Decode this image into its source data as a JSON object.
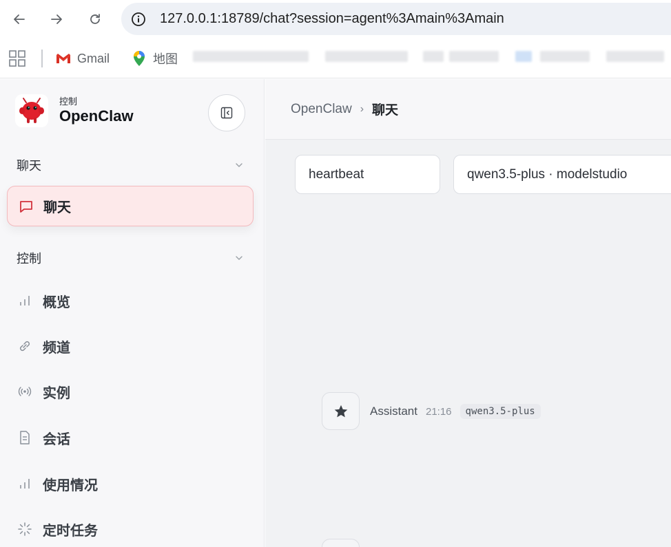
{
  "browser": {
    "url": "127.0.0.1:18789/chat?session=agent%3Amain%3Amain",
    "bookmarks": [
      {
        "label": "Gmail",
        "icon": "gmail-icon"
      },
      {
        "label": "地图",
        "icon": "maps-icon"
      }
    ]
  },
  "sidebar": {
    "brand_sub": "控制",
    "brand_title": "OpenClaw",
    "groups": [
      {
        "label": "聊天"
      },
      {
        "label": "控制"
      }
    ],
    "active_item": {
      "label": "聊天",
      "icon": "chat-bubble-icon"
    },
    "items": [
      {
        "label": "概览",
        "icon": "bar-chart-icon"
      },
      {
        "label": "频道",
        "icon": "link-icon"
      },
      {
        "label": "实例",
        "icon": "broadcast-icon"
      },
      {
        "label": "会话",
        "icon": "document-icon"
      },
      {
        "label": "使用情况",
        "icon": "bar-chart-icon"
      },
      {
        "label": "定时任务",
        "icon": "loader-icon"
      }
    ]
  },
  "main": {
    "breadcrumb": {
      "root": "OpenClaw",
      "separator": "›",
      "current": "聊天"
    },
    "session_select": "heartbeat",
    "model_select": "qwen3.5-plus · modelstudio",
    "message": {
      "sender": "Assistant",
      "time": "21:16",
      "model": "qwen3.5-plus",
      "avatar_icon": "star-icon"
    }
  },
  "colors": {
    "accent": "#d2323c",
    "active_bg": "#fde9ea"
  }
}
